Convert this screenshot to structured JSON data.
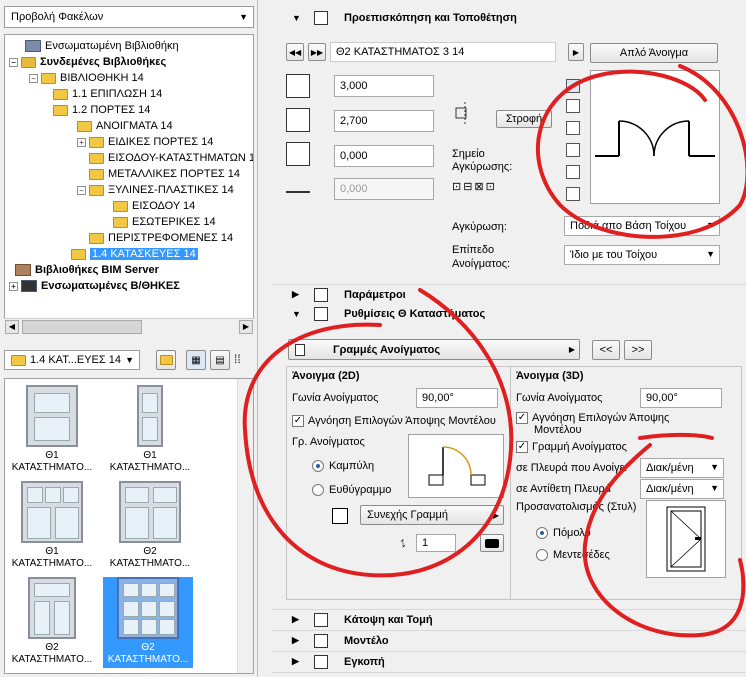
{
  "left": {
    "view_dropdown": "Προβολή Φακέλων",
    "tree": [
      {
        "label": "Ενσωματωμένη Βιβλιοθήκη",
        "bold": false
      },
      {
        "label": "Συνδεμένες Βιβλιοθήκες",
        "bold": true
      },
      {
        "label": "ΒΙΒΛΙΟΘΗΚΗ 14",
        "bold": false
      },
      {
        "label": "1.1 ΕΠΙΠΛΩΣΗ 14",
        "bold": false
      },
      {
        "label": "1.2 ΠΟΡΤΕΣ 14",
        "bold": false
      },
      {
        "label": "ΑΝΟΙΓΜΑΤΑ 14",
        "bold": false
      },
      {
        "label": "ΕΙΔΙΚΕΣ ΠΟΡΤΕΣ 14",
        "bold": false
      },
      {
        "label": "ΕΙΣΟΔΟΥ-ΚΑΤΑΣΤΗΜΑΤΩΝ 1",
        "bold": false
      },
      {
        "label": "ΜΕΤΑΛΛΙΚΕΣ ΠΟΡΤΕΣ 14",
        "bold": false
      },
      {
        "label": "ΞΥΛΙΝΕΣ-ΠΛΑΣΤΙΚΕΣ 14",
        "bold": false
      },
      {
        "label": "ΕΙΣΟΔΟΥ 14",
        "bold": false
      },
      {
        "label": "ΕΣΩΤΕΡΙΚΕΣ 14",
        "bold": false
      },
      {
        "label": "ΠΕΡΙΣΤΡΕΦΟΜΕΝΕΣ 14",
        "bold": false
      },
      {
        "label": "1.4 ΚΑΤΑΣΚΕΥΕΣ 14",
        "bold": false
      },
      {
        "label": "Βιβλιοθήκες BIM Server",
        "bold": true
      },
      {
        "label": "Ενσωματωμένες Β/ΘΗΚΕΣ",
        "bold": true
      }
    ],
    "folder_dropdown": "1.4 ΚΑΤ...ΕΥΕΣ 14",
    "thumbs": [
      {
        "line1": "Θ1",
        "line2": "ΚΑΤΑΣΤΗΜΑΤΟ..."
      },
      {
        "line1": "Θ1",
        "line2": "ΚΑΤΑΣΤΗΜΑΤΟ..."
      },
      {
        "line1": "Θ1",
        "line2": "ΚΑΤΑΣΤΗΜΑΤΟ..."
      },
      {
        "line1": "Θ2",
        "line2": "ΚΑΤΑΣΤΗΜΑΤΟ..."
      },
      {
        "line1": "Θ2",
        "line2": "ΚΑΤΑΣΤΗΜΑΤΟ..."
      },
      {
        "line1": "Θ2",
        "line2": "ΚΑΤΑΣΤΗΜΑΤΟ..."
      }
    ]
  },
  "preview": {
    "header": "Προεπισκόπηση και Τοποθέτηση",
    "object_name": "Θ2 ΚΑΤΑΣΤΗΜΑΤΟΣ 3 14",
    "simple_opening_btn": "Απλό Άνοιγμα",
    "width": "3,000",
    "height": "2,700",
    "sill": "0,000",
    "offset": "0,000",
    "rotate_btn": "Στροφή",
    "anchor_label_1": "Σημείο",
    "anchor_label_2": "Αγκύρωσης:",
    "anchoring_label": "Αγκύρωση:",
    "anchoring_value": "Ποδιά απο Βάση Τοίχου",
    "level_label_1": "Επίπεδο",
    "level_label_2": "Ανοίγματος:",
    "level_value": "Ίδιο με του Τοίχου"
  },
  "params": {
    "header": "Παράμετροι"
  },
  "settings": {
    "header": "Ρυθμίσεις Θ Καταστήματος",
    "page_dropdown": "Γραμμές Ανοίγματος",
    "prev_btn": "<<",
    "next_btn": ">>",
    "col2d_title": "Άνοιγμα (2D)",
    "col3d_title": "Άνοιγμα (3D)",
    "angle_label": "Γωνία Ανοίγματος",
    "angle_2d": "90,00°",
    "angle_3d": "90,00°",
    "ignore_2d": "Αγνόηση Επιλογών Άποψης Μοντέλου",
    "ignore_3d_1": "Αγνόηση Επιλογών Άποψης",
    "ignore_3d_2": "Μοντέλου",
    "line_3d": "Γραμμή Ανοίγματος",
    "opening_line_label": "Γρ. Ανοίγματος",
    "radio_curved": "Καμπύλη",
    "radio_straight": "Ευθύγραμμο",
    "line_type": "Συνεχής Γραμμή",
    "pen_value": "1",
    "side_open_label": "σε Πλευρά που Ανοίγει",
    "side_open_value": "Διακ/μένη",
    "side_opp_label": "σε Αντίθετη Πλευρά",
    "side_opp_value": "Διακ/μένη",
    "orient_label": "Προσανατολισμός (Στυλ)",
    "radio_pomolo": "Πόμολο",
    "radio_menteses": "Μεντεσέδες"
  },
  "bottom_sections": [
    {
      "label": "Κάτοψη και Τομή"
    },
    {
      "label": "Μοντέλο"
    },
    {
      "label": "Εγκοπή"
    }
  ],
  "colors": {
    "selection": "#3399ff",
    "annotation": "#e02020",
    "door_arc": "#d89a20"
  }
}
